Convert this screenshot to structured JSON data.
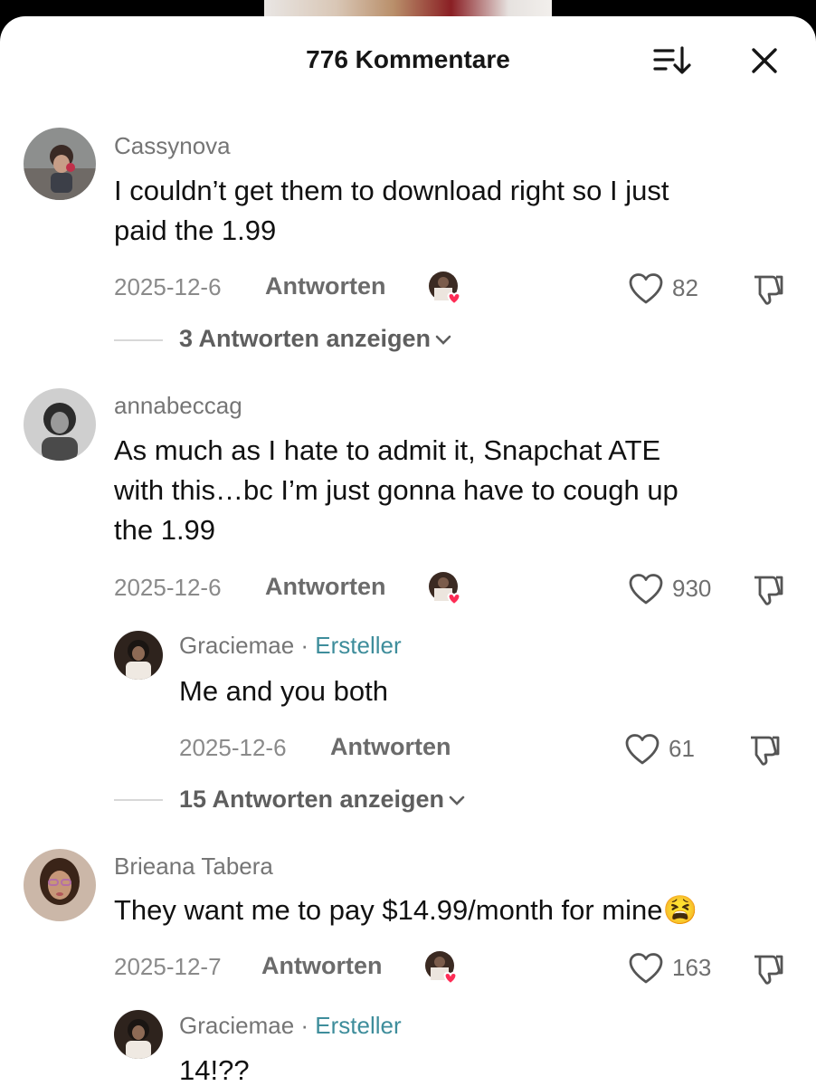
{
  "header": {
    "title": "776 Kommentare",
    "sort_icon": "sort-icon",
    "close_icon": "close-icon"
  },
  "reply_label": "Antworten",
  "comments": [
    {
      "username": "Cassynova",
      "text_lines": [
        "I couldn’t get them to download right so I just",
        "paid the 1.99"
      ],
      "date": "2025-12-6",
      "likes": "82",
      "view_replies": "3 Antworten anzeigen"
    },
    {
      "username": "annabeccag",
      "text_lines": [
        "As much as I hate to admit it, Snapchat ATE",
        "with this…bc I’m just gonna have to cough up",
        "the 1.99"
      ],
      "date": "2025-12-6",
      "likes": "930"
    },
    {
      "username": "Graciemae",
      "creator_sep": "·",
      "creator_label": "Ersteller",
      "text": "Me and you both",
      "date": "2025-12-6",
      "likes": "61",
      "view_replies": "15 Antworten anzeigen"
    },
    {
      "username": "Brieana Tabera",
      "text": "They want me to pay $14.99/month for mine😫",
      "date": "2025-12-7",
      "likes": "163"
    },
    {
      "username": "Graciemae",
      "creator_sep": "·",
      "creator_label": "Ersteller",
      "text": "14!??"
    }
  ],
  "colors": {
    "creator": "#3e8d9b",
    "meta": "#8a8a8a",
    "text": "#111111",
    "heart_badge": "#fe2c55"
  }
}
